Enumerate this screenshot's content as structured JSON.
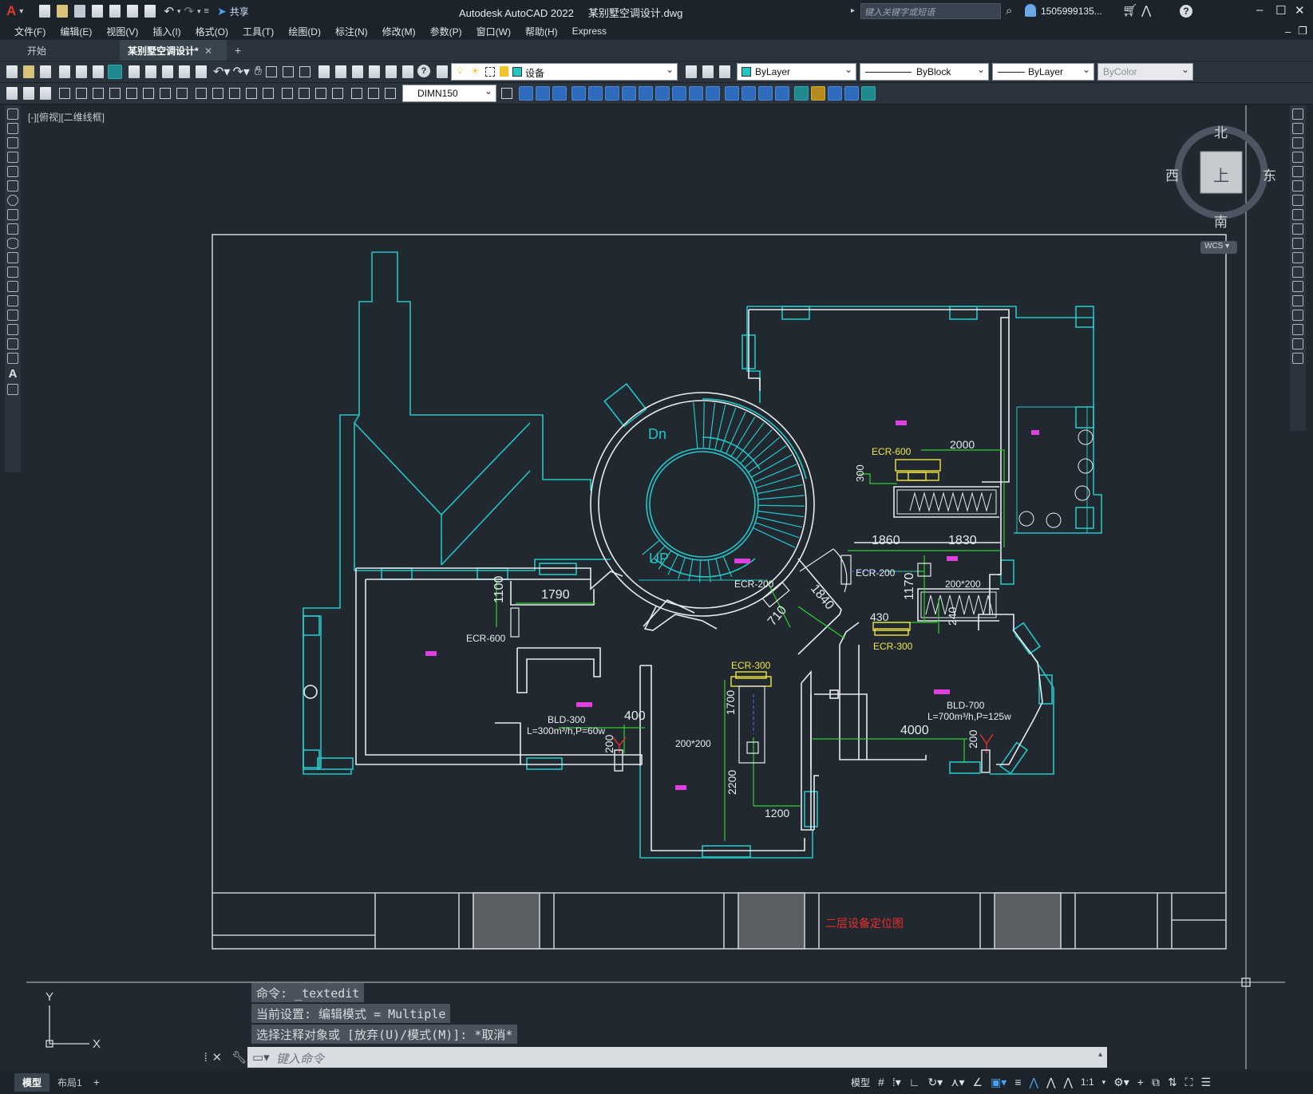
{
  "app": {
    "title": "Autodesk AutoCAD 2022",
    "file": "某别墅空调设计.dwg",
    "share_label": "共享",
    "search_placeholder": "键入关键字或短语",
    "user": "1505999135...",
    "logo": "A"
  },
  "menu": [
    "文件(F)",
    "编辑(E)",
    "视图(V)",
    "插入(I)",
    "格式(O)",
    "工具(T)",
    "绘图(D)",
    "标注(N)",
    "修改(M)",
    "参数(P)",
    "窗口(W)",
    "帮助(H)",
    "Express"
  ],
  "tabs": [
    {
      "label": "开始",
      "active": false
    },
    {
      "label": "某别墅空调设计*",
      "active": true
    }
  ],
  "toolbar": {
    "layer": "设备",
    "color": "ByLayer",
    "linetype": "ByBlock",
    "lineweight": "ByLayer",
    "plotstyle": "ByColor",
    "dimstyle": "DIMN150"
  },
  "viewport": {
    "label": "[-][俯视][二维线框]",
    "compass": {
      "north": "北",
      "south": "南",
      "east": "东",
      "west": "西",
      "top": "上",
      "wcs": "WCS"
    }
  },
  "drawing": {
    "labels": {
      "ecr600_a": "ECR-600",
      "ecr600_b": "ECR-600",
      "ecr200_a": "ECR-200",
      "ecr200_b": "ECR-200",
      "ecr300_a": "ECR-300",
      "ecr300_b": "ECR-300",
      "bld300": "BLD-300",
      "bld300_spec": "L=300m³/h,P=60w",
      "bld700": "BLD-700",
      "bld700_spec": "L=700m³/h,P=125w",
      "dn": "Dn",
      "up": "UP",
      "vent_a": "200*200",
      "vent_b": "200*200",
      "title_block": "二层设备定位图"
    },
    "dims": {
      "d2000": "2000",
      "d300": "300",
      "d1860": "1860",
      "d1830": "1830",
      "d1790": "1790",
      "d1100": "1100",
      "d1170": "1170",
      "d430": "430",
      "d240": "240",
      "d1840": "1840",
      "d710": "710",
      "d400": "400",
      "d200a": "200",
      "d1700": "1700",
      "d2200": "2200",
      "d1200": "1200",
      "d4000": "4000",
      "d200b": "200"
    }
  },
  "command": {
    "line1": "命令: _textedit",
    "line2": "当前设置: 编辑模式 = Multiple",
    "line3": "选择注释对象或 [放弃(U)/模式(M)]: *取消*",
    "input_placeholder": "键入命令"
  },
  "layout_tabs": [
    {
      "label": "模型",
      "active": true
    },
    {
      "label": "布局1",
      "active": false
    }
  ],
  "status": {
    "model": "模型",
    "scale": "1:1"
  },
  "colors": {
    "wall": "#e8ecef",
    "cyan": "#23c6c6",
    "green": "#2fd12f",
    "yellow": "#f0e640",
    "magenta": "#e040e0",
    "red": "#e8302a"
  }
}
